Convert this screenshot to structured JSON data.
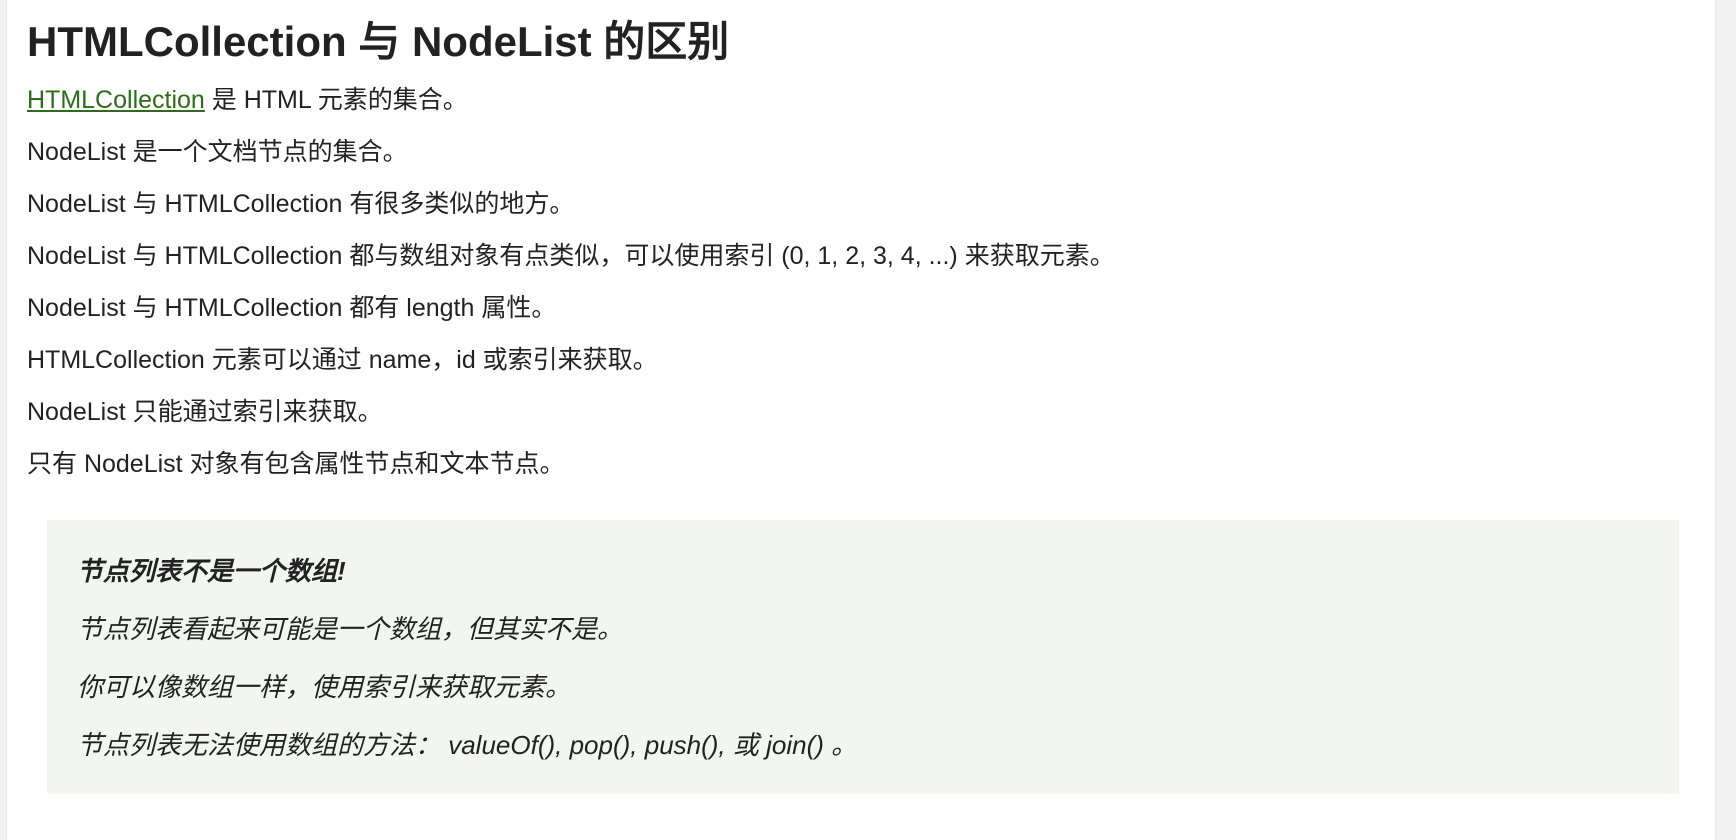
{
  "heading": "HTMLCollection 与 NodeList 的区别",
  "paragraphs": {
    "p1_link": "HTMLCollection",
    "p1_rest": " 是 HTML 元素的集合。",
    "p2": "NodeList 是一个文档节点的集合。",
    "p3": "NodeList 与 HTMLCollection 有很多类似的地方。",
    "p4": "NodeList 与 HTMLCollection 都与数组对象有点类似，可以使用索引 (0, 1, 2, 3, 4, ...) 来获取元素。",
    "p5": "NodeList 与 HTMLCollection 都有 length 属性。",
    "p6": "HTMLCollection 元素可以通过 name，id 或索引来获取。",
    "p7": "NodeList 只能通过索引来获取。",
    "p8": "只有 NodeList 对象有包含属性节点和文本节点。"
  },
  "note": {
    "title": "节点列表不是一个数组!",
    "line1": "节点列表看起来可能是一个数组，但其实不是。",
    "line2": "你可以像数组一样，使用索引来获取元素。",
    "line3": "节点列表无法使用数组的方法： valueOf(), pop(), push(), 或 join() 。"
  },
  "colors": {
    "link": "#2a6e17",
    "note_bg": "#f3f5f0",
    "text": "#222222"
  }
}
